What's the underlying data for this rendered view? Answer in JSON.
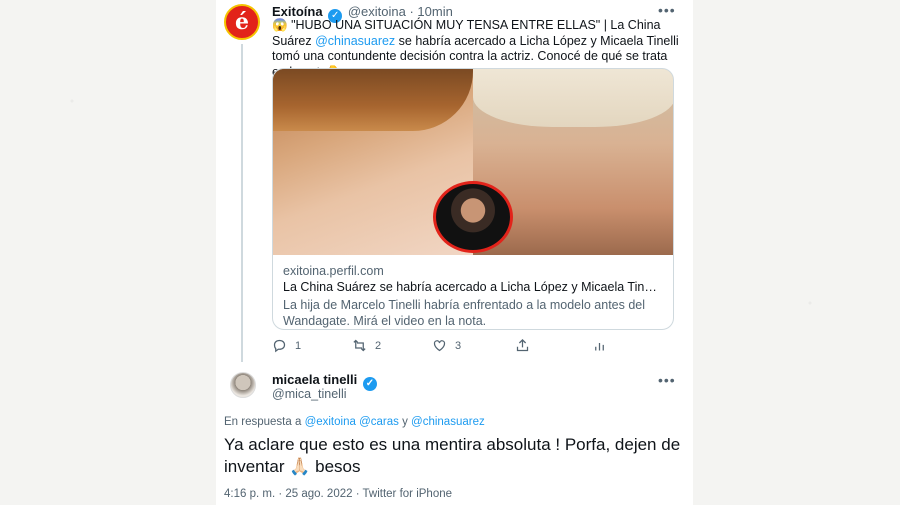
{
  "parent_tweet": {
    "author_name": "Exitoína",
    "handle": "@exitoina",
    "time": "10min",
    "text_lead": "\"HUBO UNA SITUACIÓN MUY TENSA ENTRE ELLAS\" | La China Suárez",
    "mention": "@chinasuarez",
    "text_rest": " se habría acercado a Licha López y Micaela Tinelli tomó una contundente decisión contra la actriz. Conocé de qué se trata en la nota",
    "emoji_lead": "😱",
    "emoji_tail": "👇",
    "avatar_letter": "é",
    "link_card": {
      "domain": "exitoina.perfil.com",
      "headline": "La China Suárez se habría acercado a Licha López y Micaela Tinelli to...",
      "description": "La hija de Marcelo Tinelli habría enfrentado a la modelo antes del Wandagate. Mirá el video en la nota."
    },
    "actions": {
      "replies": "1",
      "retweets": "2",
      "likes": "3"
    }
  },
  "reply_tweet": {
    "author_name": "micaela tinelli",
    "handle": "@mica_tinelli",
    "reply_prefix": "En respuesta a",
    "reply_mentions": "@exitoina @caras",
    "reply_and": "y",
    "reply_last": "@chinasuarez",
    "text_before": "Ya aclare que esto es una mentira absoluta ! Porfa, dejen de inventar",
    "emoji": "🙏🏻",
    "text_after": " besos",
    "meta": "4:16 p. m. · 25 ago. 2022 · Twitter for iPhone"
  },
  "colors": {
    "accent": "#1d9bf0",
    "secondary_text": "#536471",
    "brand_red": "#e2231a"
  }
}
